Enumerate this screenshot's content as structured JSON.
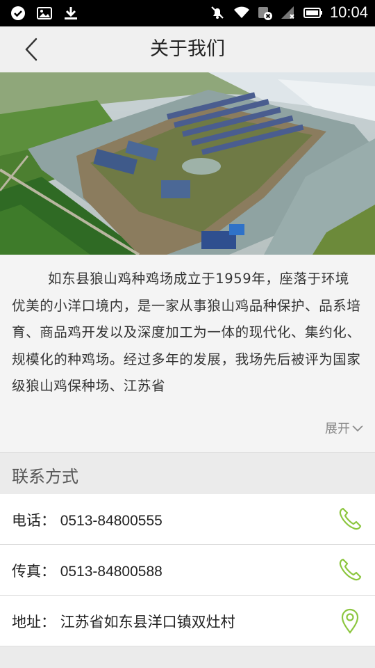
{
  "status_bar": {
    "time": "10:04",
    "icons": [
      "check-circle-icon",
      "image-icon",
      "download-icon",
      "mute-icon",
      "wifi-icon",
      "sim-icon",
      "signal-icon",
      "battery-icon"
    ]
  },
  "header": {
    "title": "关于我们",
    "back_icon": "chevron-left-icon"
  },
  "about": {
    "text": "如东县狼山鸡种鸡场成立于1959年，座落于环境优美的小洋口境内，是一家从事狼山鸡品种保护、品系培育、商品鸡开发以及深度加工为一体的现代化、集约化、规模化的种鸡场。经过多年的发展，我场先后被评为国家级狼山鸡保种场、江苏省",
    "expand_label": "展开"
  },
  "contact": {
    "section_title": "联系方式",
    "items": [
      {
        "label": "电话：",
        "value": "0513-84800555",
        "icon": "phone-icon"
      },
      {
        "label": "传真：",
        "value": "0513-84800588",
        "icon": "phone-icon"
      },
      {
        "label": "地址：",
        "value": "江苏省如东县洋口镇双灶村",
        "icon": "location-pin-icon"
      }
    ]
  },
  "colors": {
    "accent_green": "#8cc63f",
    "status_bar": "#000000",
    "title_bar": "#f0f0f0"
  }
}
